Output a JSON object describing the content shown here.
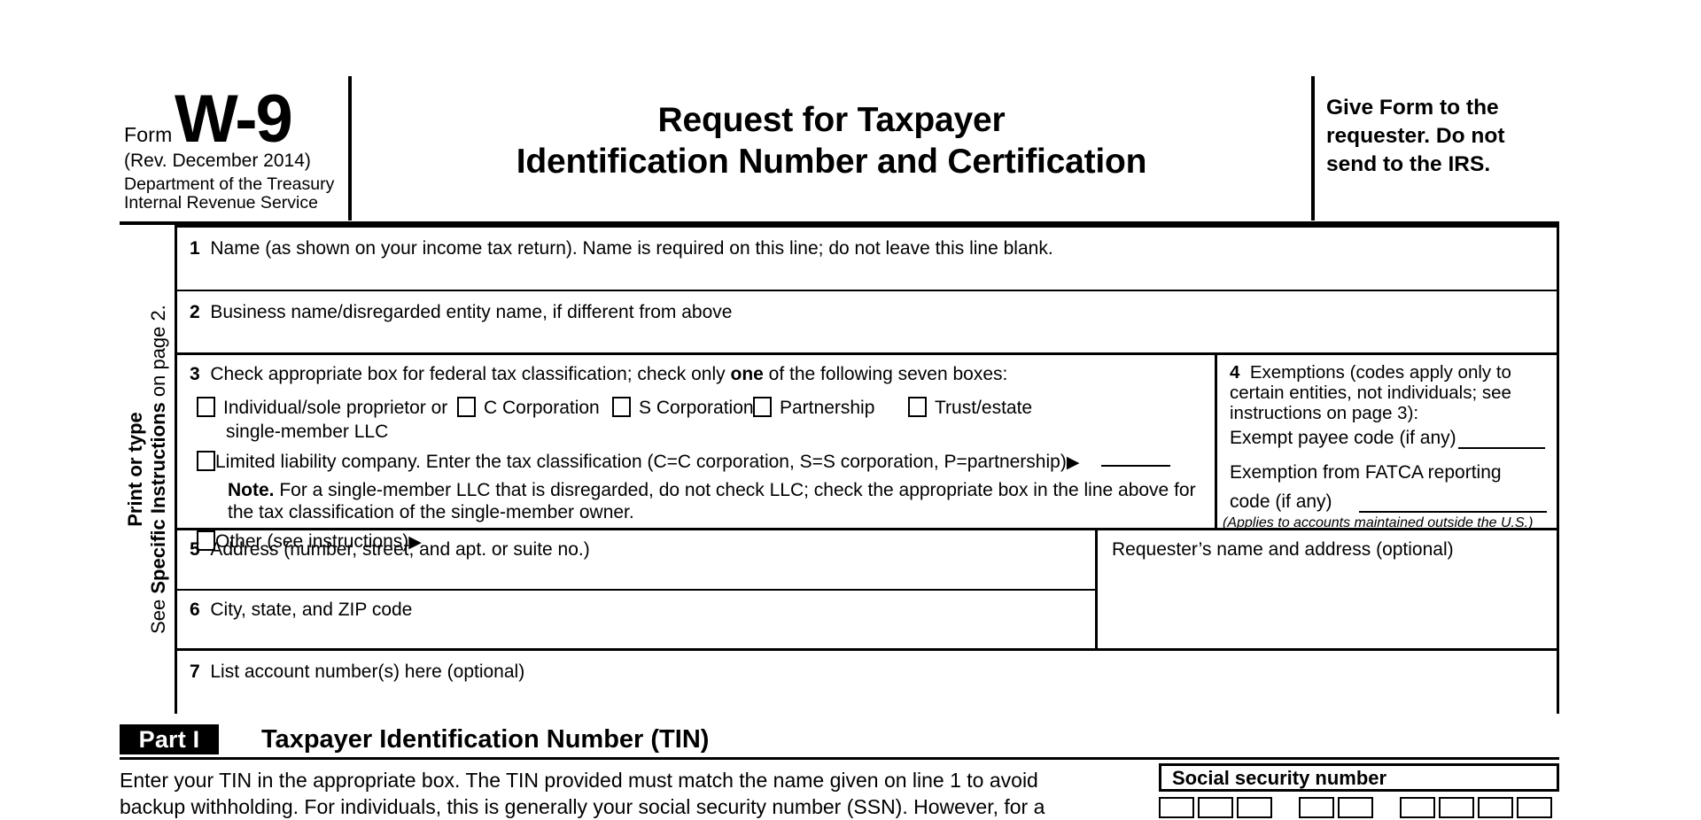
{
  "document": {
    "form_label": "Form",
    "form_number": "W-9",
    "revision": "(Rev. December 2014)",
    "department_line1": "Department of the Treasury",
    "department_line2": "Internal Revenue Service",
    "title_line1": "Request for Taxpayer",
    "title_line2": "Identification Number and Certification",
    "give_form_notice": "Give Form to the requester. Do not send to the IRS."
  },
  "sidebar": {
    "line1": "Print or type",
    "line2_prefix": "See ",
    "line2_strong": "Specific Instructions",
    "line2_suffix": " on page 2."
  },
  "fields": {
    "line1": {
      "number": "1",
      "label": "Name (as shown on your income tax return). Name is required on this line; do not leave this line blank.",
      "value": ""
    },
    "line2": {
      "number": "2",
      "label": "Business name/disregarded entity name, if different from above",
      "value": ""
    },
    "line3": {
      "number": "3",
      "label_prefix": "Check appropriate box for federal tax classification; check only ",
      "label_strong": "one",
      "label_suffix": " of the following seven boxes:",
      "checkboxes": [
        {
          "id": "individual",
          "label": "Individual/sole proprietor or",
          "label2": "single-member LLC",
          "checked": false
        },
        {
          "id": "c-corporation",
          "label": "C Corporation",
          "checked": false
        },
        {
          "id": "s-corporation",
          "label": "S Corporation",
          "checked": false
        },
        {
          "id": "partnership",
          "label": "Partnership",
          "checked": false
        },
        {
          "id": "trust-estate",
          "label": "Trust/estate",
          "checked": false
        }
      ],
      "llc": {
        "label": "Limited liability company. Enter the tax classification (C=C corporation, S=S corporation, P=partnership)",
        "arrow": "▶",
        "value": "",
        "checked": false
      },
      "note_strong": "Note.",
      "note_text": " For a single-member LLC that is disregarded, do not check LLC; check the appropriate box in the line above for the tax classification of the single-member owner.",
      "other": {
        "label": "Other (see instructions)",
        "arrow": "▶",
        "value": "",
        "checked": false
      }
    },
    "line4": {
      "number": "4",
      "heading": "Exemptions (codes apply only to certain entities, not individuals; see instructions on page 3):",
      "exempt_payee_label": "Exempt payee code (if any)",
      "exempt_payee_value": "",
      "fatca_label_line1": "Exemption from FATCA reporting",
      "fatca_label_line2": "code (if any)",
      "fatca_value": "",
      "applies_note": "(Applies to accounts maintained outside the U.S.)"
    },
    "line5": {
      "number": "5",
      "label": "Address (number, street, and apt. or suite no.)",
      "value": ""
    },
    "line6": {
      "number": "6",
      "label": "City, state, and ZIP code",
      "value": ""
    },
    "line7": {
      "number": "7",
      "label": "List account number(s) here (optional)",
      "value": ""
    },
    "requester": {
      "label": "Requester’s name and address (optional)",
      "value": ""
    }
  },
  "part1": {
    "tag": "Part I",
    "title": "Taxpayer Identification Number (TIN)",
    "body_line1": "Enter your TIN in the appropriate box. The TIN provided must match the name given on line 1 to avoid",
    "body_line2": "backup withholding. For individuals, this is generally your social security number (SSN). However, for a",
    "ssn_label": "Social security number",
    "ssn_cells": [
      "",
      "",
      "",
      "",
      "",
      "",
      "",
      "",
      ""
    ]
  },
  "colors": {
    "ink": "#000000",
    "paper": "#ffffff"
  }
}
